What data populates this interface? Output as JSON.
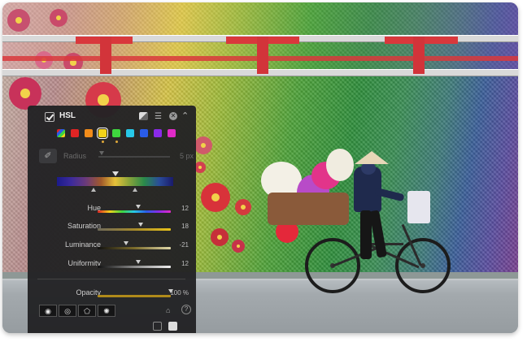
{
  "panel": {
    "title": "HSL",
    "radius_label": "Radius",
    "radius_value": "5 px",
    "colors": [
      "#9c6bd8",
      "#e02424",
      "#f28c1a",
      "#f2d21a",
      "#3ed63e",
      "#27c8e8",
      "#2a5ce8",
      "#8a2ae8",
      "#e02ac8"
    ],
    "selected_color": "#f2d21a",
    "sliders": [
      {
        "label": "Hue",
        "value": "12",
        "level": 0.56
      },
      {
        "label": "Saturation",
        "value": "18",
        "level": 0.59
      },
      {
        "label": "Luminance",
        "value": "-21",
        "level": 0.39
      },
      {
        "label": "Uniformity",
        "value": "12",
        "level": 0.56
      }
    ],
    "opacity": {
      "label": "Opacity",
      "value": "100 %",
      "level": 1.0
    },
    "icons": {
      "compare": "compare-icon",
      "menu": "menu-icon",
      "close": "close-icon",
      "collapse": "chevron-up-icon",
      "eyedropper": "eyedropper-icon",
      "help": "help-icon"
    }
  }
}
